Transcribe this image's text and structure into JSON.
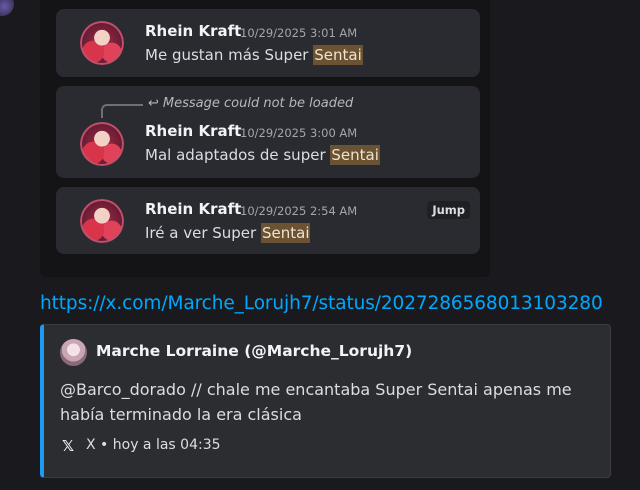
{
  "messages": [
    {
      "author": "Rhein Kraft",
      "timestamp": "10/29/2025 3:01 AM",
      "text_before": "Me gustan más Super ",
      "highlight": "Sentai"
    },
    {
      "reply_notice": "Message could not be loaded",
      "author": "Rhein Kraft",
      "timestamp": "10/29/2025 3:00 AM",
      "text_before": "Mal adaptados de super ",
      "highlight": "Sentai"
    },
    {
      "author": "Rhein Kraft",
      "timestamp": "10/29/2025 2:54 AM",
      "text_before": "Iré a ver Super ",
      "highlight": "Sentai",
      "jump_label": "Jump"
    }
  ],
  "link": "https://x.com/Marche_Lorujh7/status/2027286568013103280",
  "embed": {
    "author": "Marche Lorraine (@Marche_Lorujh7)",
    "description": "@Barco_dorado // chale me encantaba Super Sentai apenas me había terminado la era clásica",
    "footer": "X • hoy a las 04:35",
    "accent_color": "#1d9bf0"
  },
  "colors": {
    "highlight_bg": "#6b5232",
    "link": "#00a8fc"
  }
}
